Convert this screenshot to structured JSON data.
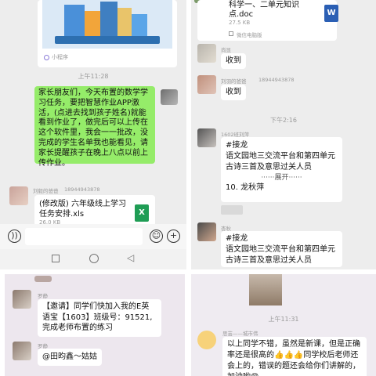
{
  "top_left": {
    "card_source": "小程序",
    "time1": "上午11:28",
    "green_message": "家长朋友们，今天布置的数学学习任务，要把智慧作业APP激活，(点进去找到孩子姓名)就能看到作业了，做完后可以上传在这个软件里，我会一一批改，没完成的学生名单我也能看见，请家长提醒孩子在晚上八点以前上传作业。",
    "file_sender": "刘毅的爸爸",
    "file_sender_phone": "18944943878",
    "file_name": "(修改版) 六年级线上学习任务安排.xls",
    "file_size": "26.0 KB",
    "file_icon": "X",
    "input_icons": [
      "voice-icon",
      "emoji-icon",
      "plus-icon"
    ],
    "nav_icons": [
      "square-icon",
      "circle-icon",
      "triangle-icon"
    ]
  },
  "top_right": {
    "doc_name": "科学一、二单元知识点.doc",
    "doc_size": "27.5 KB",
    "doc_icon": "W",
    "doc_source": "微信电脑版",
    "sender1": "尚显",
    "reply1": "收到",
    "sender2": "刘羽的爸爸",
    "sender2_phone": "18944943878",
    "reply2": "收到",
    "time2": "下午2:16",
    "sender3": "1602班刘萍",
    "jielong1": "#接龙\n语文园地三交流平台和第四单元古诗三首及意思过关人员",
    "expand": "展开",
    "jielong1_last": "10. 龙秋萍",
    "sender4": "杏秋",
    "jielong2": "#接龙\n语文园地三交流平台和第四单元古诗三首及意思过关人员"
  },
  "bottom_left": {
    "sender1": "罗静",
    "message1": "【邀请】同学们快加入我的E英语宝【1603】班级号：91521,完成老师布置的练习",
    "sender2": "罗静",
    "message2": "@田昀鑫～姑姑"
  },
  "bottom_right": {
    "time": "上午11:31",
    "sender": "思芸——城市伟",
    "message": "以上同学不错，虽然是新课，但是正确率还是很高的👍👍👍同学校后老师还会上的，错误的题还会给你们讲解的，加油哟😊"
  }
}
